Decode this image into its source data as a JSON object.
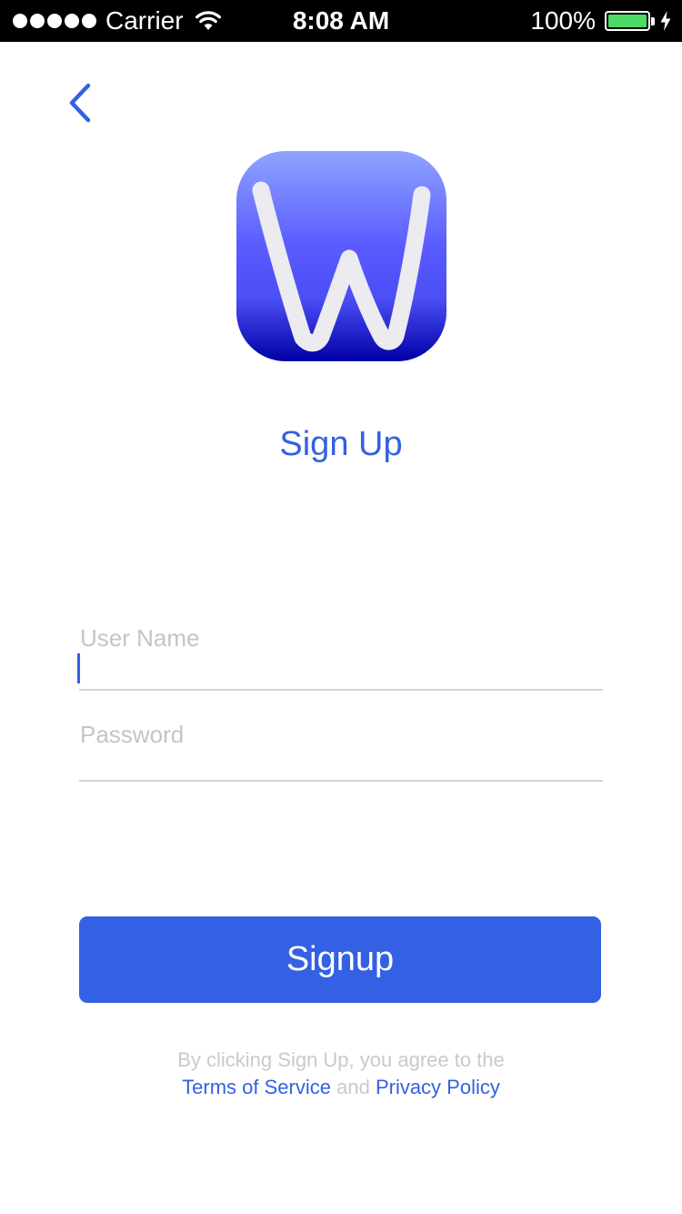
{
  "status_bar": {
    "carrier": "Carrier",
    "time": "8:08 AM",
    "battery_percent": "100%",
    "battery_level": 1.0,
    "signal_bars": 5,
    "icons": [
      "wifi-icon",
      "battery-icon",
      "charging-bolt-icon"
    ]
  },
  "nav": {
    "back_icon": "chevron-left-icon"
  },
  "logo": {
    "icon": "app-logo-w",
    "gradient_colors": [
      "#8fa3ff",
      "#5a5cff",
      "#0000a6"
    ],
    "letter_color": "#ebebf0"
  },
  "page": {
    "title": "Sign Up"
  },
  "form": {
    "username": {
      "label": "User Name",
      "value": ""
    },
    "password": {
      "label": "Password",
      "value": ""
    }
  },
  "signup_button": {
    "label": "Signup"
  },
  "legal": {
    "prefix": "By clicking Sign Up, you agree to the",
    "terms_link": "Terms of Service",
    "conjunction": "and",
    "privacy_link": "Privacy Policy"
  },
  "colors": {
    "accent": "#3461e3",
    "placeholder": "#c4c4ca",
    "divider": "#d4d4d8",
    "battery": "#4cd964",
    "status_bar_bg": "#000000"
  }
}
